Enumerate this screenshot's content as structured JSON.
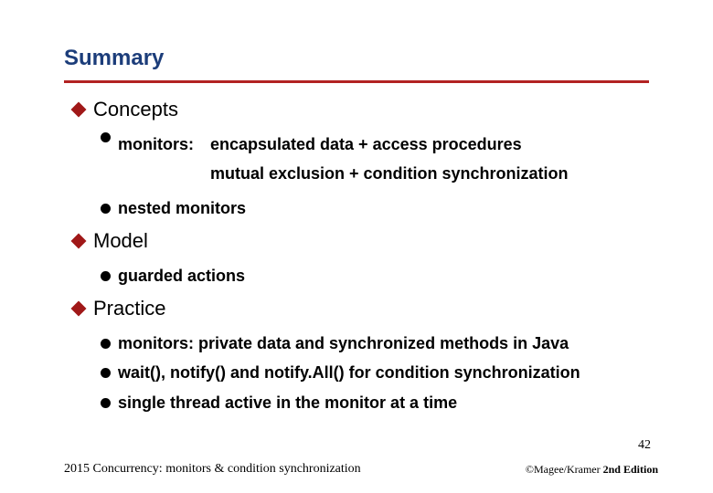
{
  "title": "Summary",
  "sections": [
    {
      "heading": "Concepts",
      "items": [
        {
          "label": "monitors:",
          "lines": [
            "encapsulated data + access procedures",
            "mutual exclusion + condition synchronization"
          ]
        },
        {
          "label": "nested monitors"
        }
      ]
    },
    {
      "heading": "Model",
      "items": [
        {
          "label": "guarded actions"
        }
      ]
    },
    {
      "heading": "Practice",
      "items": [
        {
          "label": "monitors: private data and synchronized methods in Java"
        },
        {
          "label": "wait(), notify() and notify.All() for condition synchronization"
        },
        {
          "label": "single thread active in the monitor at a time"
        }
      ]
    }
  ],
  "page_number": "42",
  "footer_left": "2015  Concurrency: monitors & condition synchronization",
  "footer_right_prefix": "©Magee/Kramer ",
  "footer_right_sup": "2nd",
  "footer_right_suffix": " Edition"
}
